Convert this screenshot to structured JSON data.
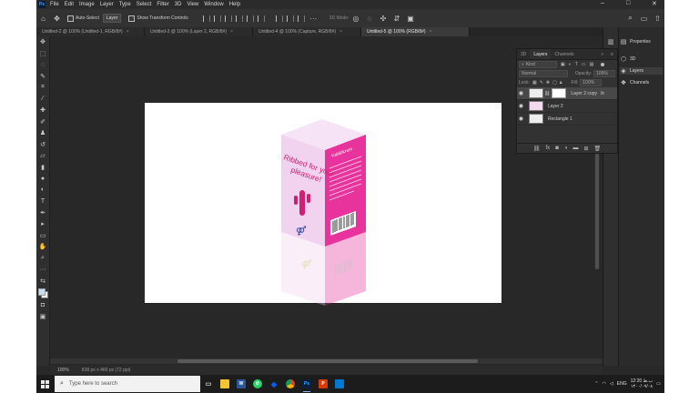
{
  "menubar": {
    "app_badge": "Ps",
    "items": [
      "File",
      "Edit",
      "Image",
      "Layer",
      "Type",
      "Select",
      "Filter",
      "3D",
      "View",
      "Window",
      "Help"
    ],
    "minimize": "–",
    "maximize": "□",
    "close": "✕"
  },
  "options_bar": {
    "auto_select_label": "Auto-Select",
    "layer_select": "Layer",
    "show_transform_label": "Show Transform Controls",
    "mode_3d_label": "3D Mode:"
  },
  "doc_tabs": [
    {
      "label": "Untitled-2 @ 100% (Untitled-1, RGB/8#)",
      "close": "×"
    },
    {
      "label": "Untitled-3 @ 100% (Layer 2, RGB/8#)",
      "close": "×"
    },
    {
      "label": "Untitled-4 @ 100% (Capture, RGB/8#)",
      "close": "×"
    },
    {
      "label": "Untitled-5 @ 100% (RGB/8#)",
      "close": "×"
    }
  ],
  "artwork": {
    "tagline_line1": "Ribbed for your",
    "tagline_line2": "pleasure!",
    "brand": "Kalabkram",
    "box_left_color": "#f1d3ef",
    "box_right_color": "#e8329c",
    "box_top_color": "#f6e3f5",
    "accent_color": "#d21e73"
  },
  "status": {
    "zoom": "100%",
    "doc_size": "838 px x 460 px (72 ppi)"
  },
  "right_panels": [
    {
      "label": "Properties",
      "icon": "properties-icon"
    },
    {
      "label": "3D",
      "icon": "cube-icon"
    },
    {
      "label": "Layers",
      "icon": "layers-icon"
    },
    {
      "label": "Channels",
      "icon": "channels-icon"
    }
  ],
  "layers_panel": {
    "tabs": [
      "3D",
      "Layers",
      "Channels"
    ],
    "filter_kind": "Kind",
    "blend_mode": "Normal",
    "opacity_label": "Opacity:",
    "opacity_value": "100%",
    "lock_label": "Lock:",
    "fill_label": "Fill:",
    "fill_value": "100%",
    "layers": [
      {
        "name": "Layer 2 copy",
        "fx": "fx",
        "selected": true
      },
      {
        "name": "Layer 2",
        "selected": false
      },
      {
        "name": "Rectangle 1",
        "selected": false
      }
    ]
  },
  "taskbar": {
    "search_placeholder": "Type here to search",
    "apps": [
      {
        "icon": "task-view-icon",
        "glyph": "▭",
        "color": "#1c1c1c"
      },
      {
        "icon": "file-explorer-icon",
        "glyph": "",
        "color": "#f5c431"
      },
      {
        "icon": "word-icon",
        "glyph": "W",
        "color": "#2b579a"
      },
      {
        "icon": "whatsapp-icon",
        "glyph": "✆",
        "color": "#25d366"
      },
      {
        "icon": "dropbox-icon",
        "glyph": "◆",
        "color": "#0061fe"
      },
      {
        "icon": "chrome-icon",
        "glyph": "◉",
        "color": "#db4437"
      },
      {
        "icon": "photoshop-icon",
        "glyph": "Ps",
        "color": "#0a1f3d"
      },
      {
        "icon": "wps-icon",
        "glyph": "P",
        "color": "#d83b01"
      },
      {
        "icon": "photos-icon",
        "glyph": "▲",
        "color": "#0078d4"
      }
    ],
    "language": "ENG",
    "time": "12:20 ب.ظ",
    "date": "۱۴۰۰/۰۹/۰۸"
  }
}
